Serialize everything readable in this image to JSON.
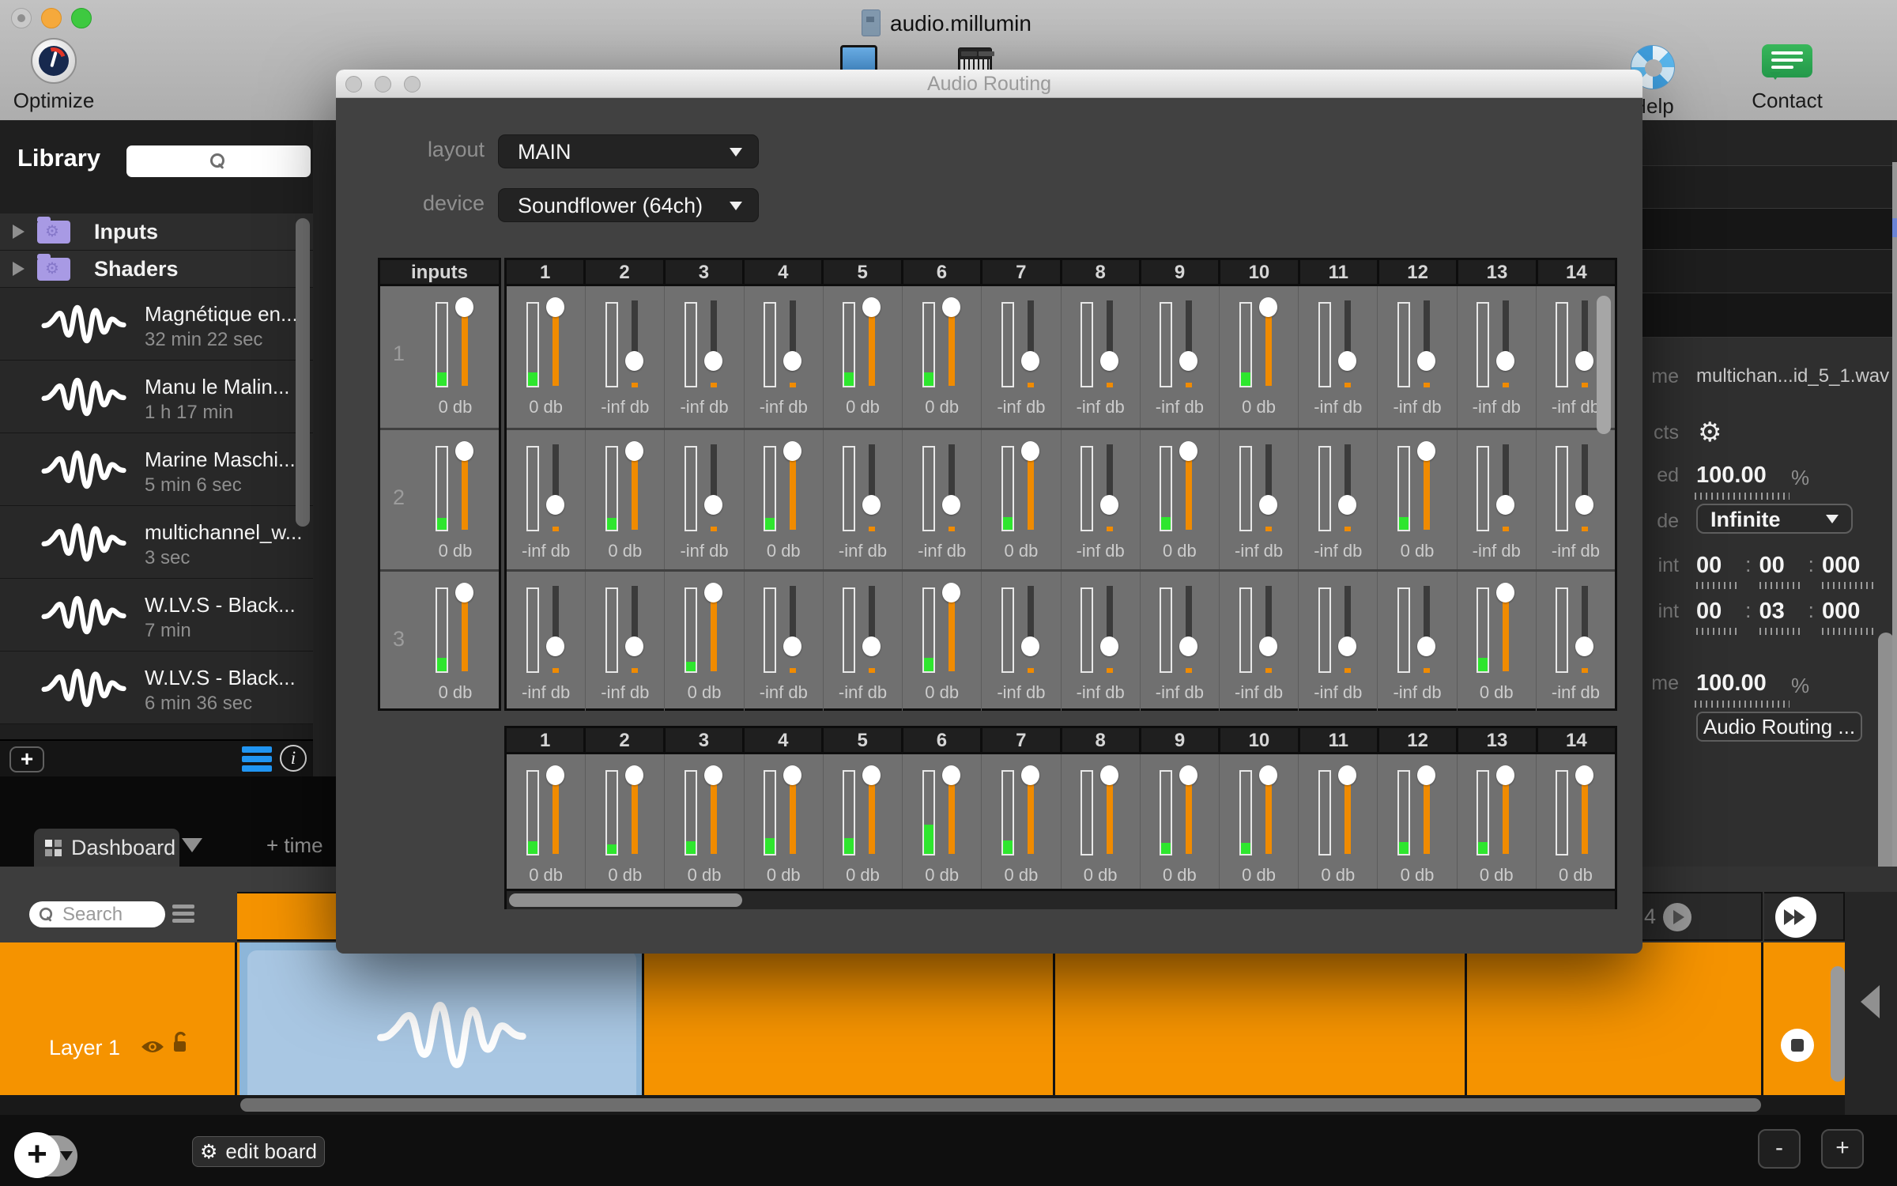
{
  "window": {
    "title": "audio.millumin"
  },
  "toolbar": {
    "optimize": "Optimize",
    "help": "Help",
    "contact": "Contact"
  },
  "dialog": {
    "title": "Audio Routing",
    "layout_label": "layout",
    "layout_value": "MAIN",
    "device_label": "device",
    "device_value": "Soundflower (64ch)",
    "matrix": {
      "corner_header": "inputs",
      "columns": [
        "1",
        "2",
        "3",
        "4",
        "5",
        "6",
        "7",
        "8",
        "9",
        "10",
        "11",
        "12",
        "13",
        "14"
      ],
      "rows": [
        {
          "label": "1",
          "input": {
            "db": "0 db",
            "meter": 0.16
          },
          "cells": [
            {
              "db": "0 db",
              "meter": 0.16
            },
            {
              "db": "-inf db",
              "meter": 0
            },
            {
              "db": "-inf db",
              "meter": 0
            },
            {
              "db": "-inf db",
              "meter": 0
            },
            {
              "db": "0 db",
              "meter": 0.16
            },
            {
              "db": "0 db",
              "meter": 0.16
            },
            {
              "db": "-inf db",
              "meter": 0
            },
            {
              "db": "-inf db",
              "meter": 0
            },
            {
              "db": "-inf db",
              "meter": 0
            },
            {
              "db": "0 db",
              "meter": 0.16
            },
            {
              "db": "-inf db",
              "meter": 0
            },
            {
              "db": "-inf db",
              "meter": 0
            },
            {
              "db": "-inf db",
              "meter": 0
            },
            {
              "db": "-inf db",
              "meter": 0
            }
          ]
        },
        {
          "label": "2",
          "input": {
            "db": "0 db",
            "meter": 0.14
          },
          "cells": [
            {
              "db": "-inf db",
              "meter": 0
            },
            {
              "db": "0 db",
              "meter": 0.14
            },
            {
              "db": "-inf db",
              "meter": 0
            },
            {
              "db": "0 db",
              "meter": 0.14
            },
            {
              "db": "-inf db",
              "meter": 0
            },
            {
              "db": "-inf db",
              "meter": 0
            },
            {
              "db": "0 db",
              "meter": 0.15
            },
            {
              "db": "-inf db",
              "meter": 0
            },
            {
              "db": "0 db",
              "meter": 0.15
            },
            {
              "db": "-inf db",
              "meter": 0
            },
            {
              "db": "-inf db",
              "meter": 0
            },
            {
              "db": "0 db",
              "meter": 0.15
            },
            {
              "db": "-inf db",
              "meter": 0
            },
            {
              "db": "-inf db",
              "meter": 0
            }
          ]
        },
        {
          "label": "3",
          "input": {
            "db": "0 db",
            "meter": 0.16
          },
          "cells": [
            {
              "db": "-inf db",
              "meter": 0
            },
            {
              "db": "-inf db",
              "meter": 0
            },
            {
              "db": "0 db",
              "meter": 0.12
            },
            {
              "db": "-inf db",
              "meter": 0
            },
            {
              "db": "-inf db",
              "meter": 0
            },
            {
              "db": "0 db",
              "meter": 0.16
            },
            {
              "db": "-inf db",
              "meter": 0
            },
            {
              "db": "-inf db",
              "meter": 0
            },
            {
              "db": "-inf db",
              "meter": 0
            },
            {
              "db": "-inf db",
              "meter": 0
            },
            {
              "db": "-inf db",
              "meter": 0
            },
            {
              "db": "-inf db",
              "meter": 0
            },
            {
              "db": "0 db",
              "meter": 0.16
            },
            {
              "db": "-inf db",
              "meter": 0
            }
          ]
        }
      ]
    },
    "outputs": {
      "columns": [
        "1",
        "2",
        "3",
        "4",
        "5",
        "6",
        "7",
        "8",
        "9",
        "10",
        "11",
        "12",
        "13",
        "14"
      ],
      "cells": [
        {
          "db": "0 db",
          "meter": 0.15
        },
        {
          "db": "0 db",
          "meter": 0.12
        },
        {
          "db": "0 db",
          "meter": 0.15
        },
        {
          "db": "0 db",
          "meter": 0.19
        },
        {
          "db": "0 db",
          "meter": 0.19
        },
        {
          "db": "0 db",
          "meter": 0.36
        },
        {
          "db": "0 db",
          "meter": 0.16
        },
        {
          "db": "0 db",
          "meter": 0
        },
        {
          "db": "0 db",
          "meter": 0.13
        },
        {
          "db": "0 db",
          "meter": 0.13
        },
        {
          "db": "0 db",
          "meter": 0
        },
        {
          "db": "0 db",
          "meter": 0.14
        },
        {
          "db": "0 db",
          "meter": 0.14
        },
        {
          "db": "0 db",
          "meter": 0
        }
      ]
    }
  },
  "library": {
    "title": "Library",
    "folders": [
      {
        "label": "Inputs"
      },
      {
        "label": "Shaders"
      }
    ],
    "items": [
      {
        "name": "Magnétique en...",
        "duration": "32 min 22 sec"
      },
      {
        "name": "Manu le Malin...",
        "duration": "1 h  17 min"
      },
      {
        "name": "Marine Maschi...",
        "duration": "5 min 6 sec"
      },
      {
        "name": "multichannel_w...",
        "duration": "3 sec"
      },
      {
        "name": "W.LV.S - Black...",
        "duration": "7 min"
      },
      {
        "name": "W.LV.S - Black...",
        "duration": "6 min 36 sec"
      }
    ]
  },
  "workspace": {
    "dashboard_tab": "Dashboard",
    "timeline_tab_partial": "+ time",
    "search_placeholder": "Search",
    "layer_label": "Layer 1",
    "cue_number": "4",
    "edit_board": "edit board",
    "zoom_out": "-",
    "zoom_in": "+"
  },
  "properties": {
    "separator": ":",
    "fields": [
      {
        "label": "me",
        "value": "multichan...id_5_1.wav"
      },
      {
        "label": "cts"
      },
      {
        "label": "ed",
        "value": "100.00",
        "unit": "%"
      },
      {
        "label": "de",
        "value": "Infinite"
      },
      {
        "label": "int",
        "segments": [
          "00",
          "00",
          "000"
        ]
      },
      {
        "label": "int",
        "segments": [
          "00",
          "03",
          "000"
        ]
      },
      {
        "label": "me",
        "value": "100.00",
        "unit": "%"
      },
      {
        "button": "Audio Routing ..."
      }
    ]
  },
  "colors": {
    "accent_orange": "#f59300",
    "meter_green": "#2ee62e",
    "clip_blue": "#a9c7e3",
    "list_blue": "#2196f3"
  }
}
